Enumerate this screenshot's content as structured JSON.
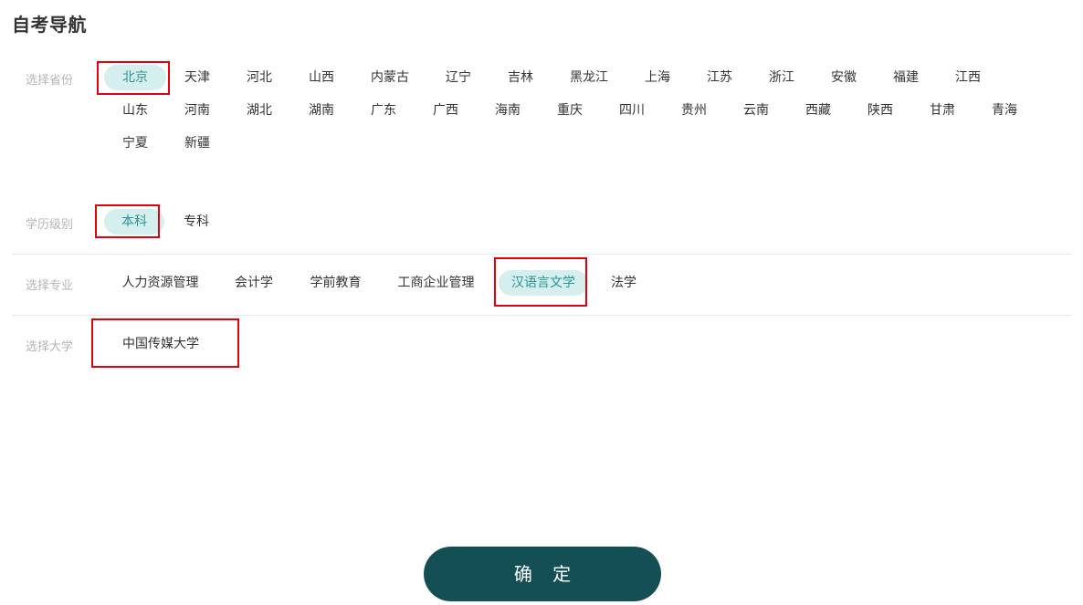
{
  "page": {
    "title": "自考导航",
    "confirm_label": "确 定"
  },
  "province_row": {
    "label": "选择省份",
    "selected": "北京",
    "items": [
      "北京",
      "天津",
      "河北",
      "山西",
      "内蒙古",
      "辽宁",
      "吉林",
      "黑龙江",
      "上海",
      "江苏",
      "浙江",
      "安徽",
      "福建",
      "江西",
      "山东",
      "河南",
      "湖北",
      "湖南",
      "广东",
      "广西",
      "海南",
      "重庆",
      "四川",
      "贵州",
      "云南",
      "西藏",
      "陕西",
      "甘肃",
      "青海",
      "宁夏",
      "新疆"
    ]
  },
  "education_row": {
    "label": "学历级别",
    "selected": "本科",
    "items": [
      "本科",
      "专科"
    ]
  },
  "major_row": {
    "label": "选择专业",
    "selected": "汉语言文学",
    "items": [
      "人力资源管理",
      "会计学",
      "学前教育",
      "工商企业管理",
      "汉语言文学",
      "法学"
    ]
  },
  "university_row": {
    "label": "选择大学",
    "items": [
      "中国传媒大学"
    ]
  },
  "colors": {
    "accent": "#2a9494",
    "selected_bg": "#d5eeee",
    "button_bg": "#134f55",
    "annotation_red": "#e3000f"
  }
}
